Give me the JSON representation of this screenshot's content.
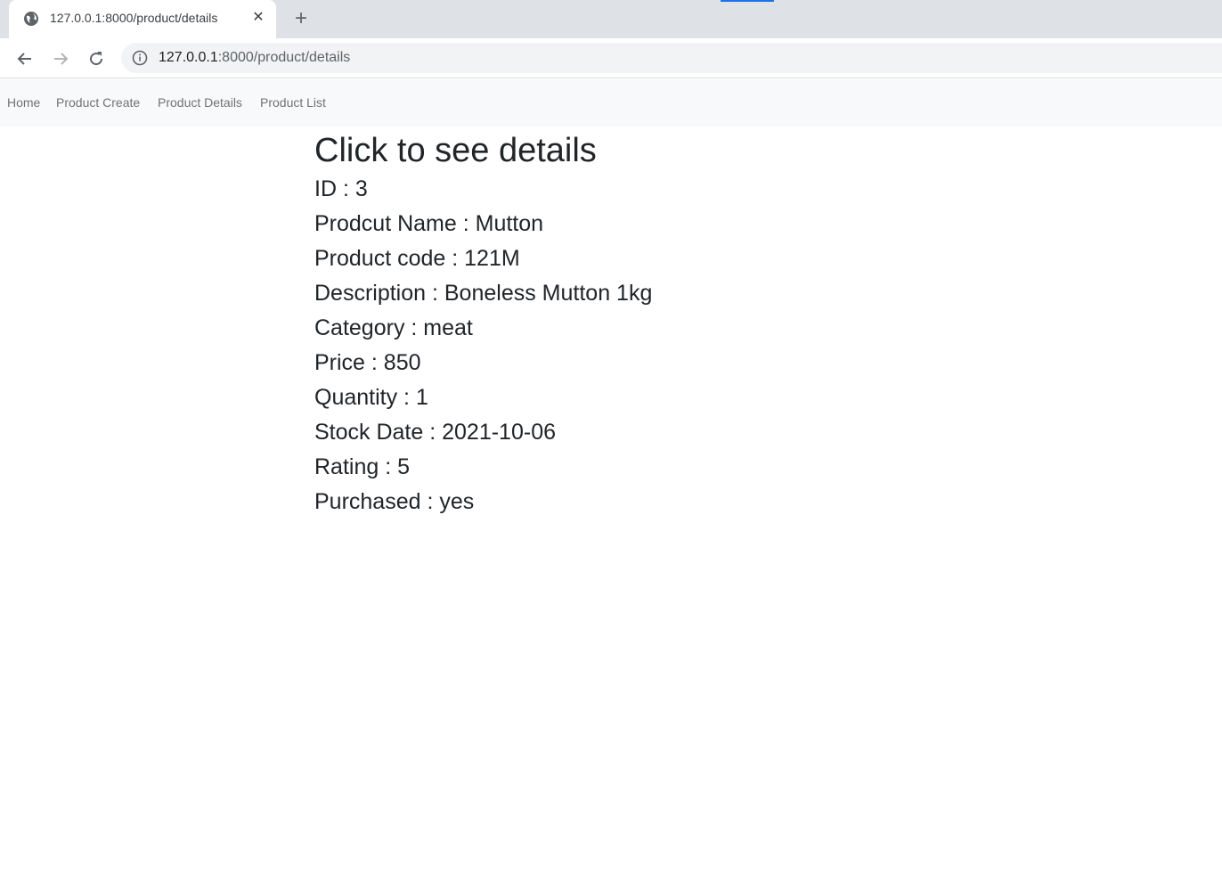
{
  "browser": {
    "tab_title": "127.0.0.1:8000/product/details",
    "close_glyph": "✕",
    "new_tab_glyph": "+",
    "url_host": "127.0.0.1",
    "url_rest": ":8000/product/details",
    "accent_color": "#1a73e8"
  },
  "navbar": {
    "links": [
      "Home",
      "Product Create",
      "Product Details",
      "Product List"
    ]
  },
  "main": {
    "heading": "Click to see details",
    "details": [
      "ID : 3",
      "Prodcut Name : Mutton",
      "Product code : 121M",
      "Description : Boneless Mutton 1kg",
      "Category : meat",
      "Price : 850",
      "Quantity : 1",
      "Stock Date : 2021-10-06",
      "Rating : 5",
      "Purchased : yes"
    ]
  }
}
